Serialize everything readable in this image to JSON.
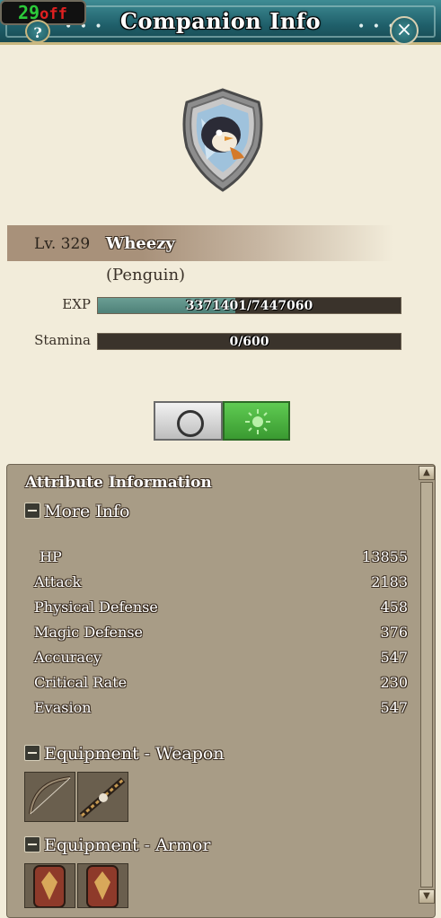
{
  "window": {
    "title": "Companion Info",
    "help_label": "?",
    "close_label": "×"
  },
  "overlay": {
    "fps_value": "29",
    "fps_suffix": "off"
  },
  "companion": {
    "level_text": "Lv. 329",
    "name": "Wheezy",
    "species": "(Penguin)"
  },
  "exp": {
    "label": "EXP",
    "text": "3371401/7447060",
    "current": 3371401,
    "max": 7447060
  },
  "stamina": {
    "label": "Stamina",
    "text": "0/600",
    "current": 0,
    "max": 600
  },
  "mode_toggle": {
    "active": "right"
  },
  "attributes": {
    "title": "Attribute Information",
    "more_info_label": "More Info",
    "stats": [
      {
        "label": "HP",
        "value": "13855"
      },
      {
        "label": "Attack",
        "value": "2183"
      },
      {
        "label": "Physical Defense",
        "value": "458"
      },
      {
        "label": "Magic Defense",
        "value": "376"
      },
      {
        "label": "Accuracy",
        "value": "547"
      },
      {
        "label": "Critical Rate",
        "value": "230"
      },
      {
        "label": "Evasion",
        "value": "547"
      }
    ],
    "weapon_label": "Equipment - Weapon",
    "armor_label": "Equipment - Armor"
  },
  "colors": {
    "titlebar": "#1f5f6a",
    "exp_fill": "#5a8c82",
    "toggle_active": "#4fb543",
    "panel_bg": "#a89c86"
  }
}
